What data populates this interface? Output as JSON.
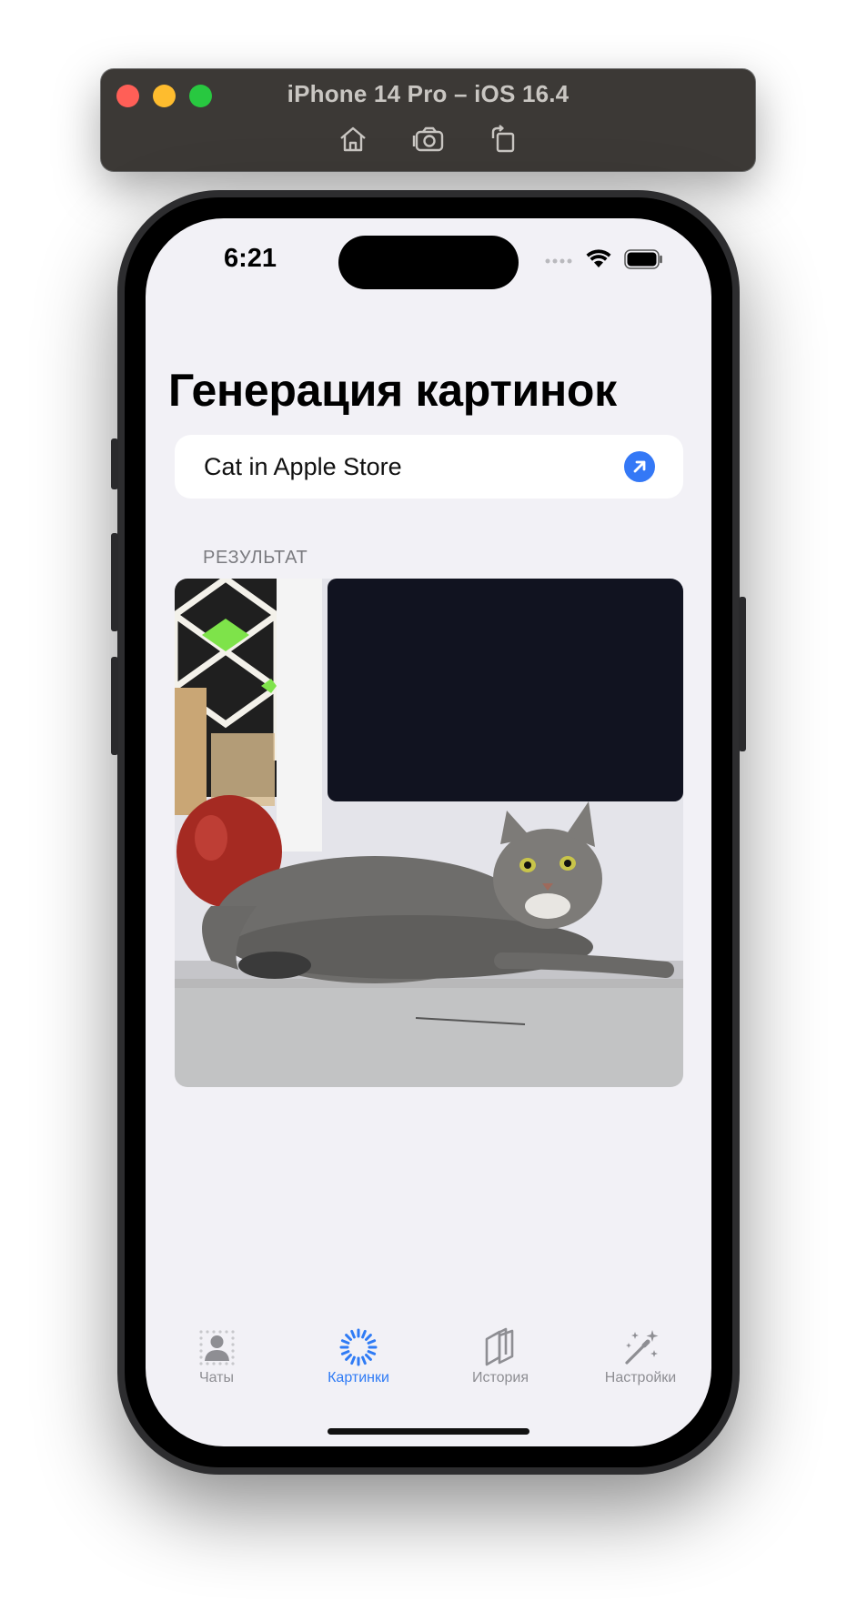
{
  "simulator": {
    "title": "iPhone 14 Pro – iOS 16.4",
    "tools": [
      "home-icon",
      "screenshot-icon",
      "rotate-icon"
    ]
  },
  "status_bar": {
    "time": "6:21"
  },
  "screen": {
    "title": "Генерация картинок",
    "prompt": {
      "value": "Cat in Apple Store",
      "send_icon": "arrow-up-right-circle-icon"
    },
    "result_header": "РЕЗУЛЬТАТ",
    "result_image_icon": "generated-cat-image"
  },
  "tabbar": {
    "tabs": [
      {
        "label": "Чаты",
        "icon": "person-icon",
        "active": false
      },
      {
        "label": "Картинки",
        "icon": "spinner-icon",
        "active": true
      },
      {
        "label": "История",
        "icon": "stacked-pages-icon",
        "active": false
      },
      {
        "label": "Настройки",
        "icon": "sparkles-icon",
        "active": false
      }
    ]
  },
  "colors": {
    "accent": "#3478f6",
    "screen_background": "#f2f1f6",
    "inactive_tab": "#8e8e93"
  }
}
